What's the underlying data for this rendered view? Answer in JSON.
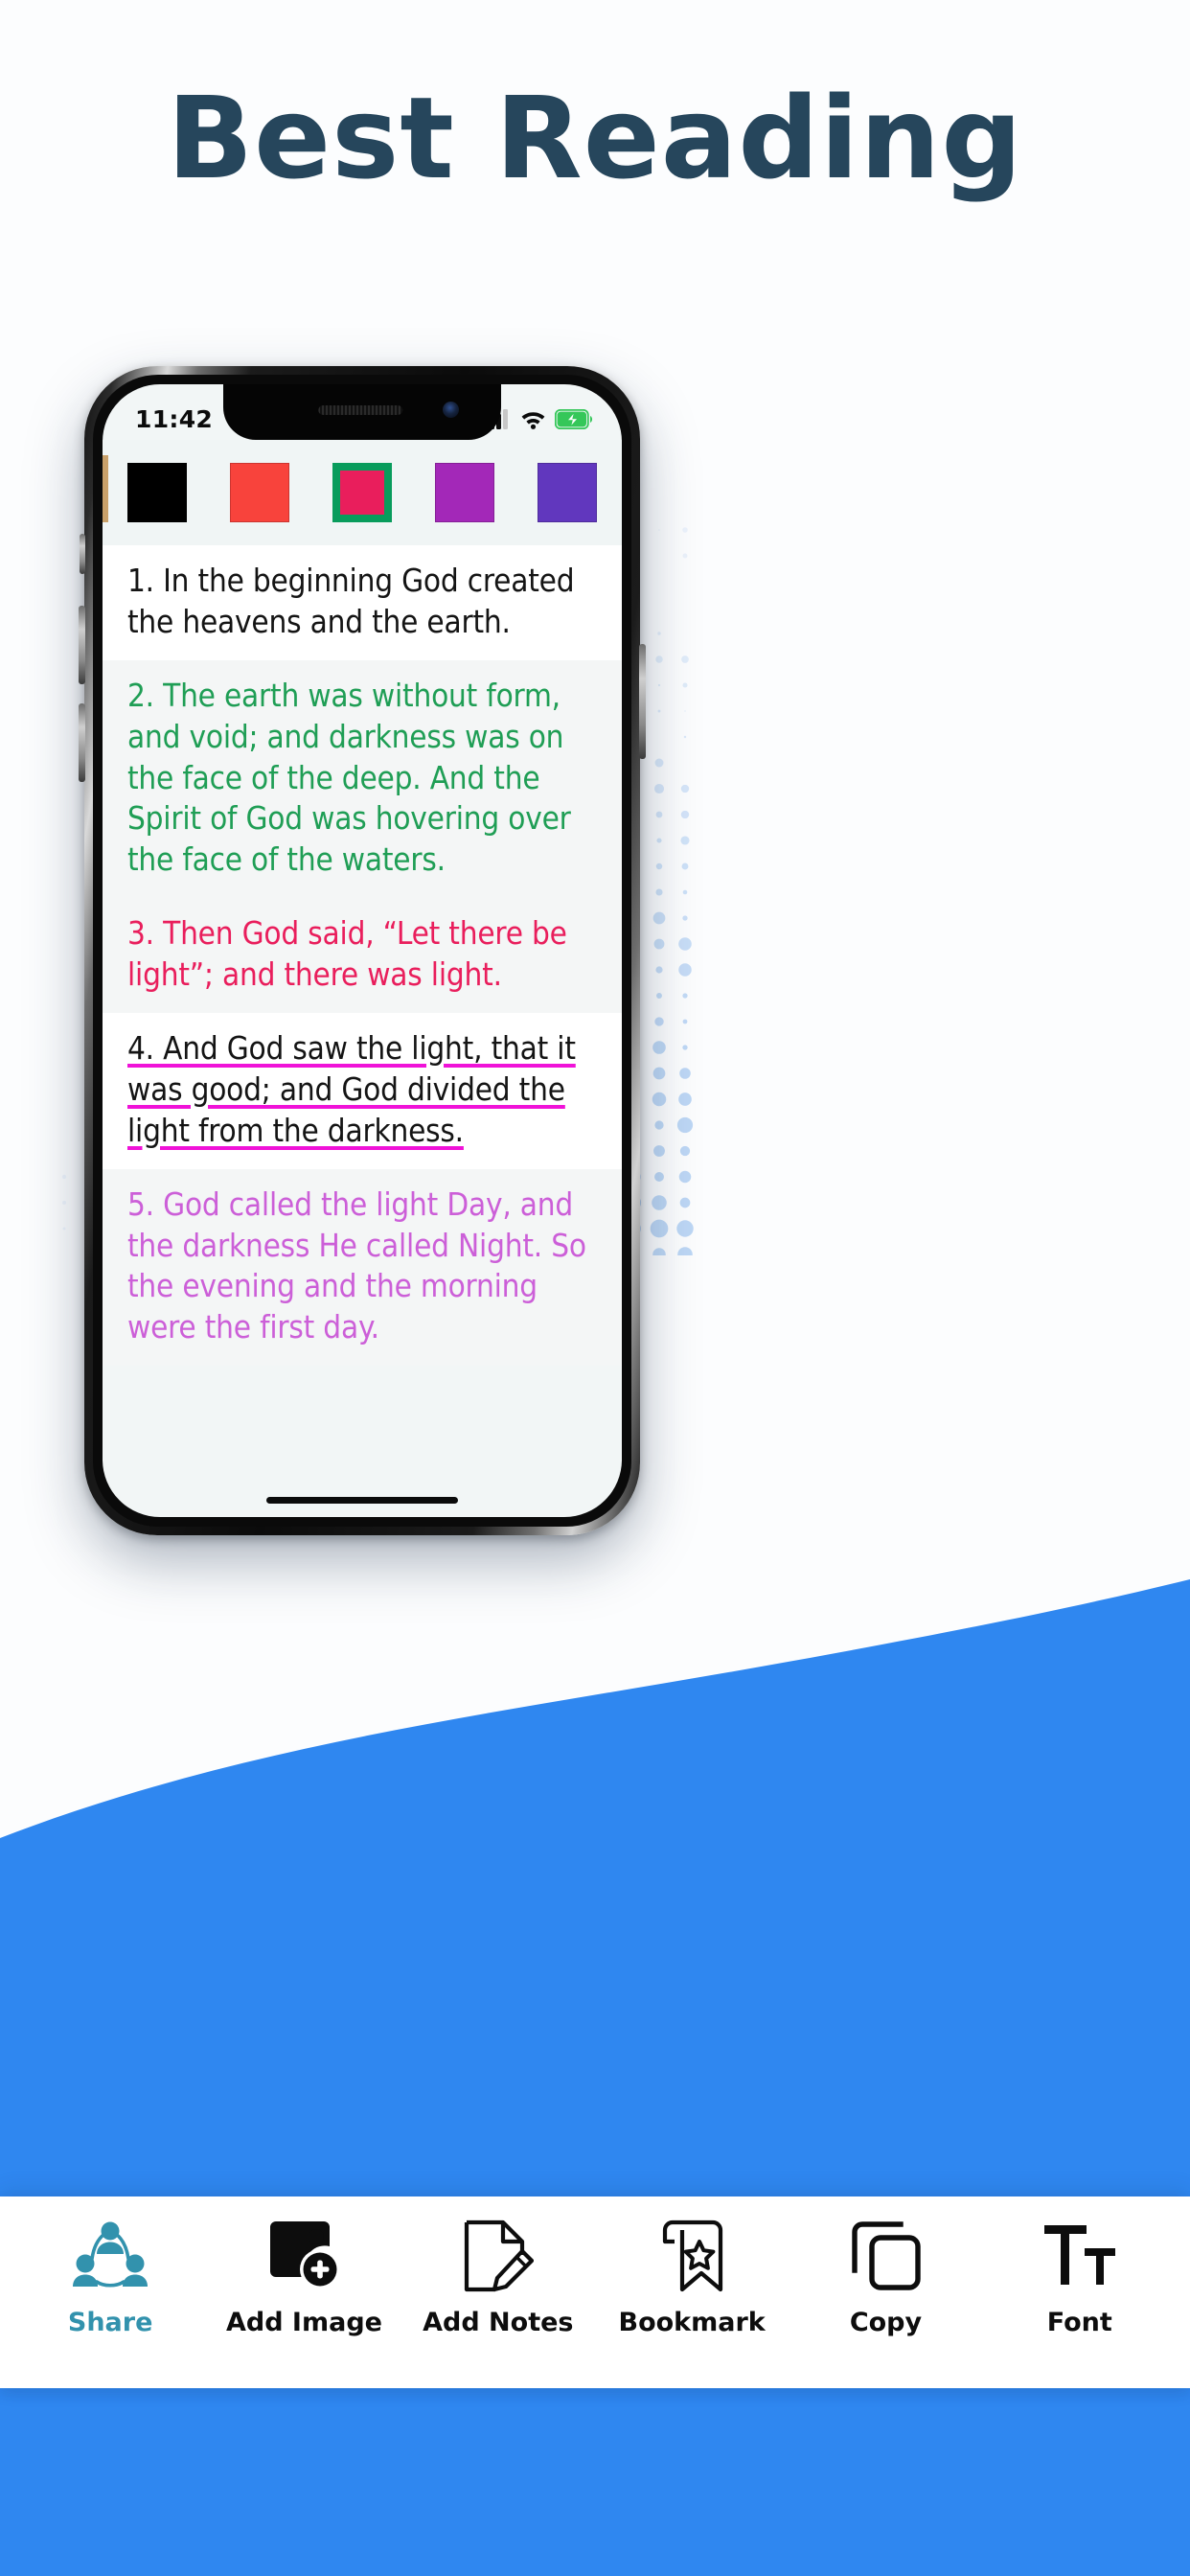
{
  "page": {
    "headline": "Best Reading",
    "headline_color": "#26465C",
    "background_color": "#FCFDFE",
    "wave_color": "#2F87F0",
    "dot_color": "#BDD7F5"
  },
  "phone": {
    "status_bar": {
      "time": "11:42",
      "signal_icon": "cellular-signal-icon",
      "wifi_icon": "wifi-icon",
      "battery_icon": "battery-charging-icon",
      "battery_color": "#35C759"
    },
    "screen_bg": "#F2F6F6"
  },
  "color_toolbar": {
    "swatches": [
      {
        "name": "swatch-black",
        "color": "#000000",
        "selected": false
      },
      {
        "name": "swatch-red",
        "color": "#F8433C",
        "selected": false
      },
      {
        "name": "swatch-crimson",
        "color": "#E91E5C",
        "selected": true,
        "ring": "#089C5C"
      },
      {
        "name": "swatch-magenta",
        "color": "#A328B8",
        "selected": false
      },
      {
        "name": "swatch-violet",
        "color": "#6137BE",
        "selected": false
      }
    ]
  },
  "reader": {
    "verses": [
      {
        "number": "1.",
        "text": "In the beginning God created the heavens and the earth.",
        "color": "#141414",
        "background": "#FFFFFF",
        "underline": false,
        "underline_color": ""
      },
      {
        "number": "2.",
        "text": "The earth was without form, and void; and darkness was on the face of the deep. And the Spirit of God was hovering over the face of the waters.",
        "color": "#1F9E55",
        "background": "#F4F6F6",
        "underline": false,
        "underline_color": ""
      },
      {
        "number": "3.",
        "text": "Then God said, “Let there be light”; and there was light.",
        "color": "#E91E5C",
        "background": "#F4F6F6",
        "underline": false,
        "underline_color": ""
      },
      {
        "number": "4.",
        "text": "And God saw the light, that it was good; and God divided the light from the darkness.",
        "color": "#141414",
        "background": "#FFFFFF",
        "underline": true,
        "underline_color": "#F012D8"
      },
      {
        "number": "5.",
        "text": "God called the light Day, and the darkness He called Night. So the evening and the morning were the first day.",
        "color": "#CC5FD8",
        "background": "#F4F6F6",
        "underline": false,
        "underline_color": ""
      }
    ]
  },
  "bottom_toolbar": {
    "active_color": "#3292AD",
    "items": [
      {
        "label": "Share",
        "icon": "share-people-icon",
        "active": true
      },
      {
        "label": "Add Image",
        "icon": "add-image-icon",
        "active": false
      },
      {
        "label": "Add Notes",
        "icon": "note-pencil-icon",
        "active": false
      },
      {
        "label": "Bookmark",
        "icon": "bookmark-star-icon",
        "active": false
      },
      {
        "label": "Copy",
        "icon": "copy-icon",
        "active": false
      },
      {
        "label": "Font",
        "icon": "font-size-icon",
        "active": false
      }
    ]
  }
}
